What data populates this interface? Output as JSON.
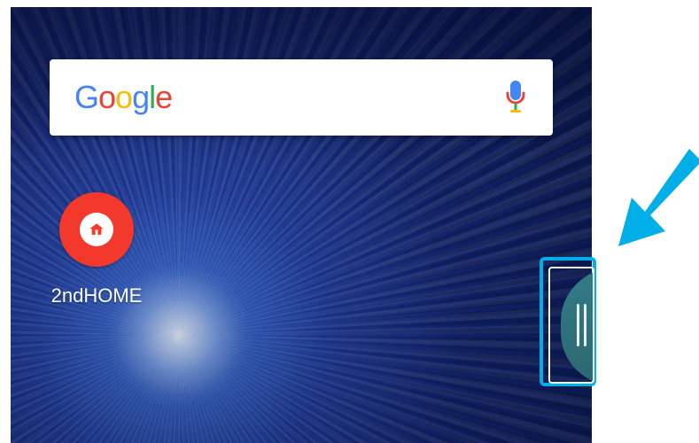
{
  "search_bar": {
    "brand_text": "Google",
    "brand_letters": [
      {
        "text": "G",
        "color": "#4285F4"
      },
      {
        "text": "o",
        "color": "#EA4335"
      },
      {
        "text": "o",
        "color": "#FBBC05"
      },
      {
        "text": "g",
        "color": "#4285F4"
      },
      {
        "text": "l",
        "color": "#34A853"
      },
      {
        "text": "e",
        "color": "#EA4335"
      }
    ],
    "mic_icon": "mic-icon"
  },
  "home_screen": {
    "app_label": "2ndHOME",
    "app_icon": "home-icon",
    "app_icon_color": "#F3392C"
  },
  "edge_panel": {
    "handle_icon": "edge-grip-icon",
    "highlight_color": "#00AEE8"
  },
  "annotation": {
    "arrow_icon": "pointer-arrow-icon",
    "arrow_color": "#00AEE8"
  }
}
